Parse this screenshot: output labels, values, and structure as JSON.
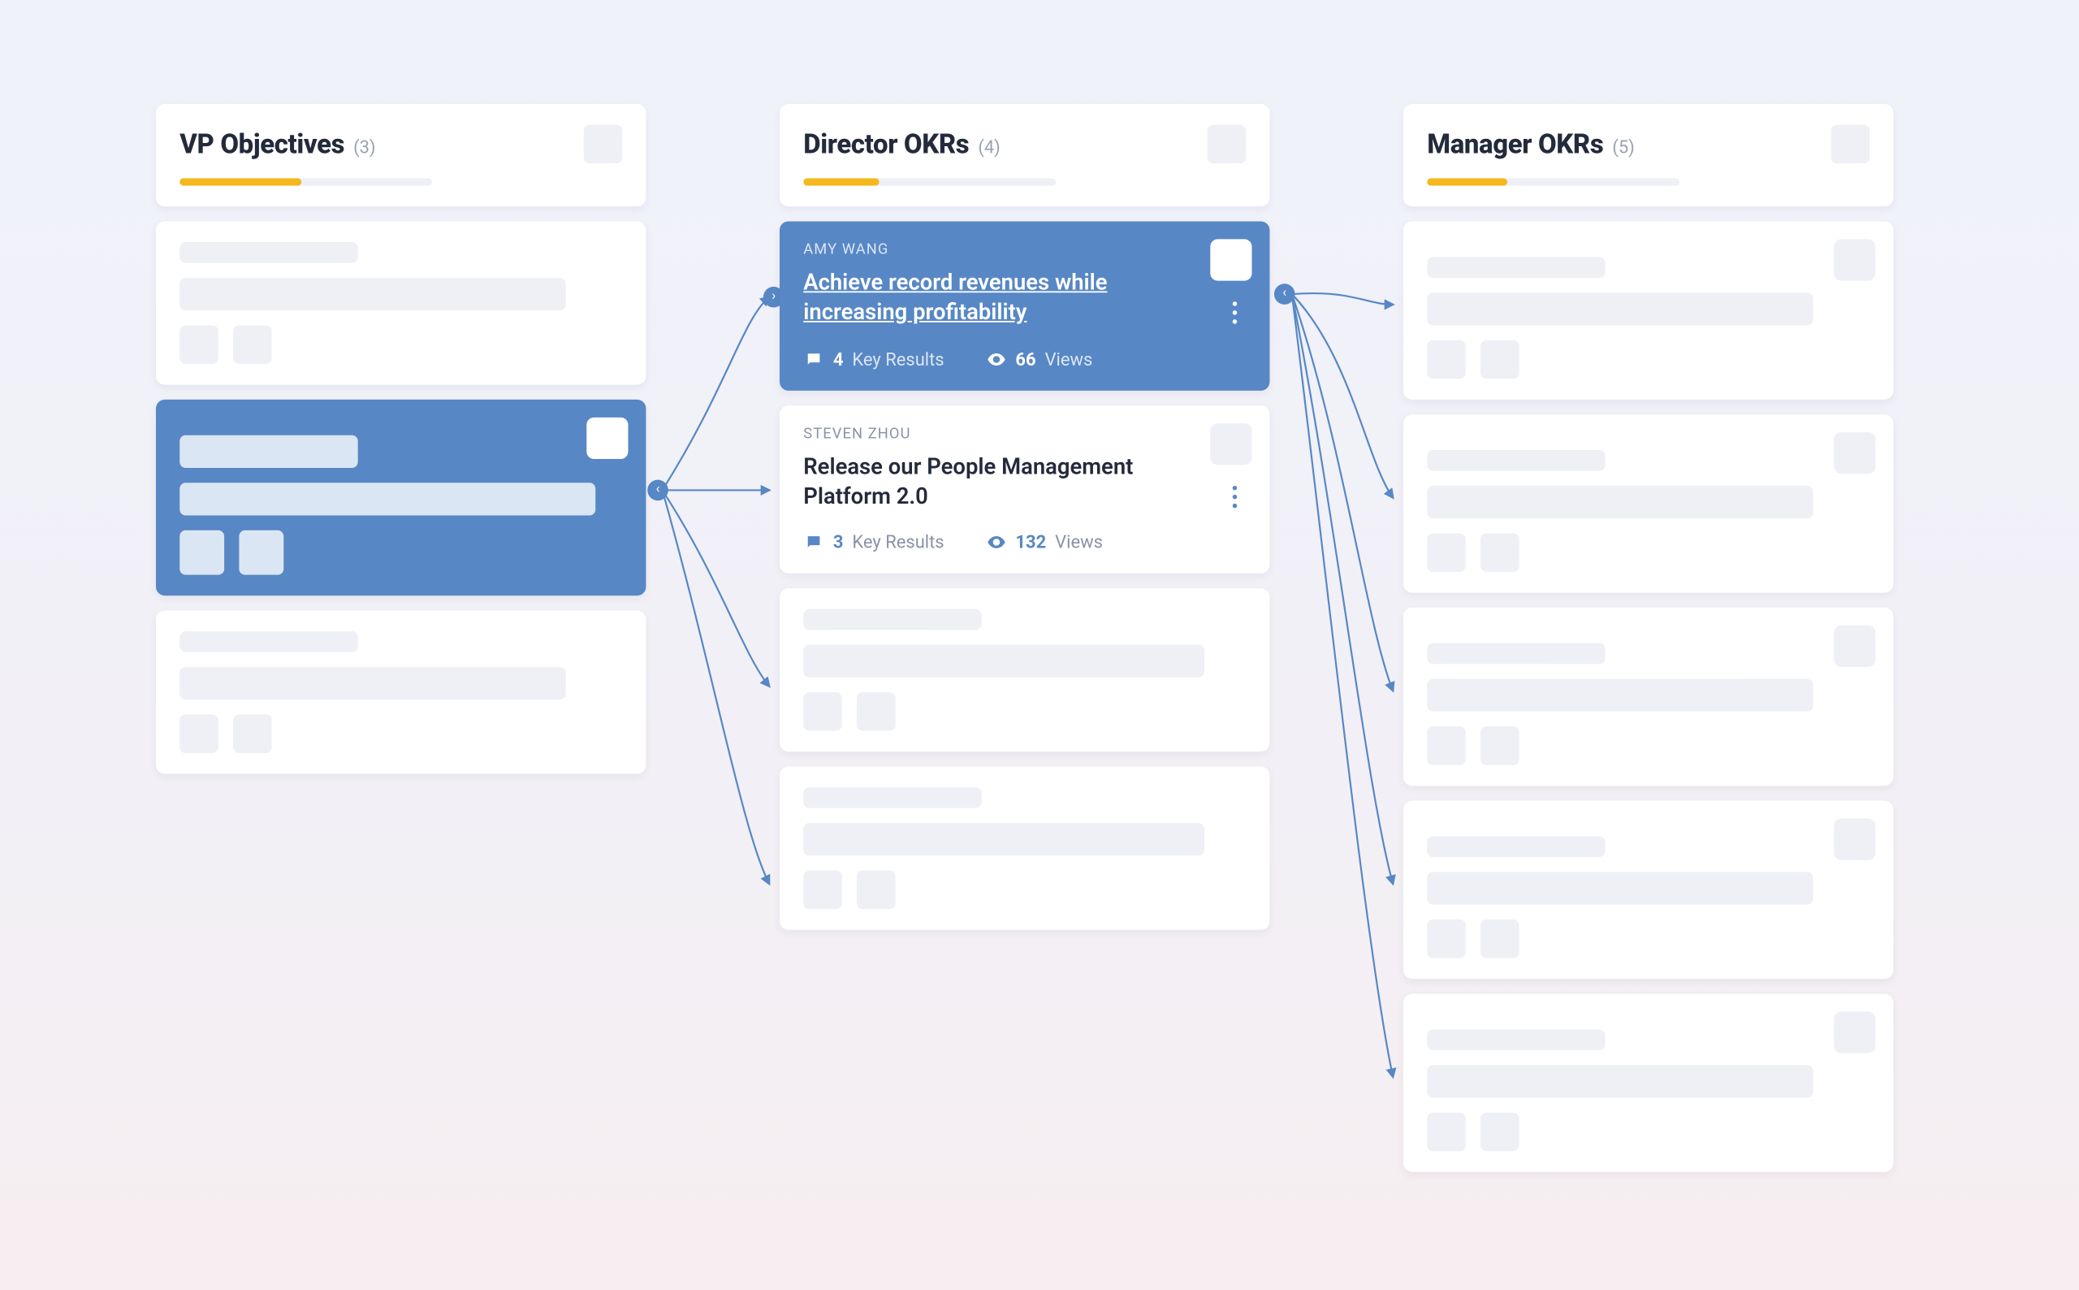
{
  "columns": [
    {
      "title": "VP Objectives",
      "count": "(3)",
      "progress_pct": 48
    },
    {
      "title": "Director OKRs",
      "count": "(4)",
      "progress_pct": 30
    },
    {
      "title": "Manager OKRs",
      "count": "(5)",
      "progress_pct": 32
    }
  ],
  "director_cards": [
    {
      "owner": "AMY WANG",
      "title": "Achieve record revenues while increasing profitability",
      "key_results_count": "4",
      "key_results_label": "Key Results",
      "views_count": "66",
      "views_label": "Views"
    },
    {
      "owner": "STEVEN ZHOU",
      "title": "Release our People Management Platform 2.0",
      "key_results_count": "3",
      "key_results_label": "Key Results",
      "views_count": "132",
      "views_label": "Views"
    }
  ]
}
